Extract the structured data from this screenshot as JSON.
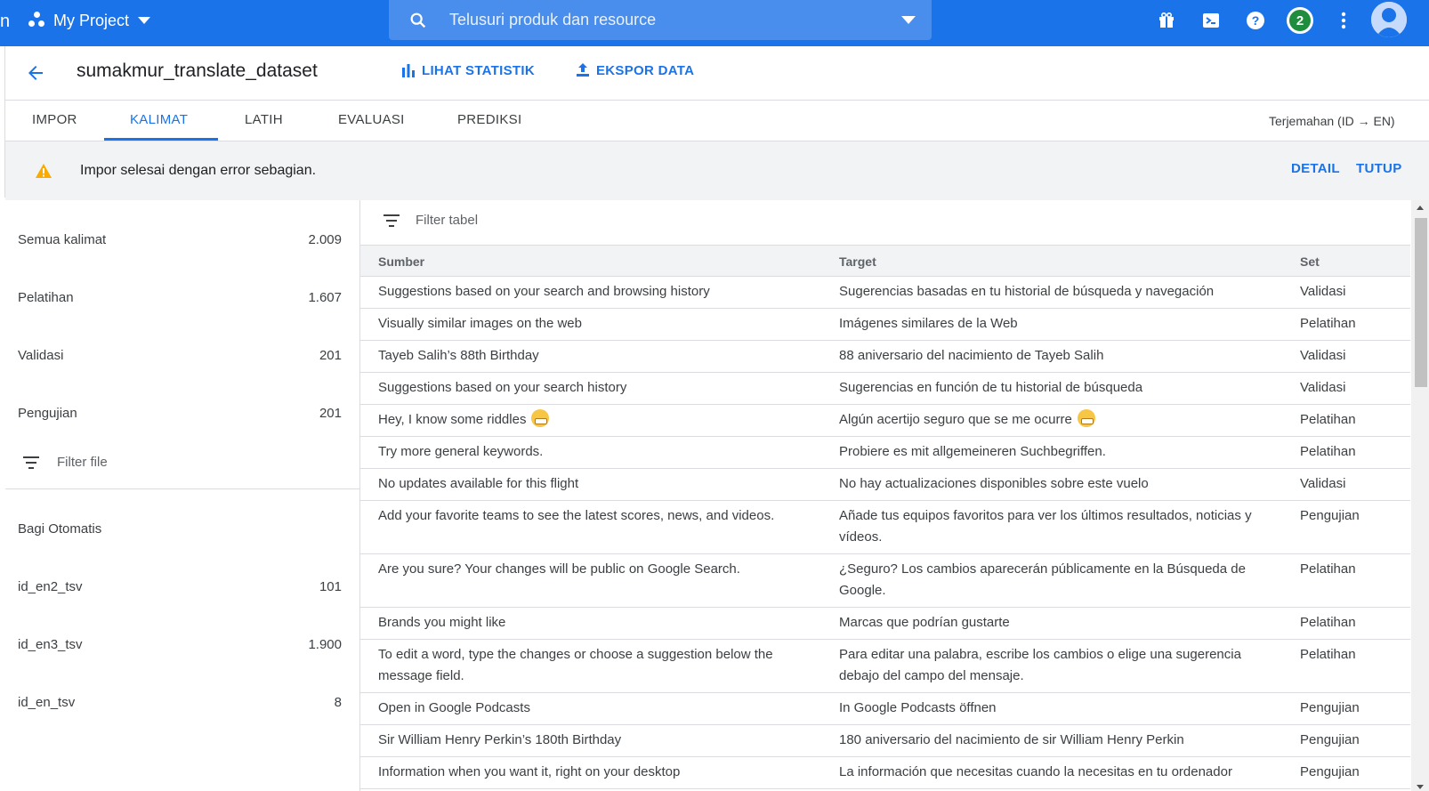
{
  "topbar": {
    "edge_glyph": "n",
    "project_name": "My Project",
    "search_placeholder": "Telusuri produk dan resource",
    "notification_count": "2",
    "colors": {
      "bar": "#1a73e8",
      "search": "#4a8eed",
      "badge": "#1e8e3e"
    }
  },
  "header": {
    "title": "sumakmur_translate_dataset",
    "actions": {
      "stats": "LIHAT STATISTIK",
      "export": "EKSPOR DATA"
    }
  },
  "tabs": [
    "IMPOR",
    "KALIMAT",
    "LATIH",
    "EVALUASI",
    "PREDIKSI"
  ],
  "active_tab": "KALIMAT",
  "language_pair": "Terjemahan (ID → EN)",
  "banner": {
    "message": "Impor selesai dengan error sebagian.",
    "detail": "DETAIL",
    "close": "TUTUP"
  },
  "sidebar": {
    "stats": [
      {
        "label": "Semua kalimat",
        "value": "2.009"
      },
      {
        "label": "Pelatihan",
        "value": "1.607"
      },
      {
        "label": "Validasi",
        "value": "201"
      },
      {
        "label": "Pengujian",
        "value": "201"
      }
    ],
    "filter_placeholder": "Filter file",
    "files": [
      {
        "label": "Bagi Otomatis",
        "value": ""
      },
      {
        "label": "id_en2_tsv",
        "value": "101"
      },
      {
        "label": "id_en3_tsv",
        "value": "1.900"
      },
      {
        "label": "id_en_tsv",
        "value": "8"
      }
    ]
  },
  "table": {
    "filter_placeholder": "Filter tabel",
    "headers": {
      "source": "Sumber",
      "target": "Target",
      "set": "Set"
    },
    "rows": [
      {
        "source": "Suggestions based on your search and browsing history",
        "target": "Sugerencias basadas en tu historial de búsqueda y navegación",
        "set": "Validasi"
      },
      {
        "source": "Visually similar images on the web",
        "target": "Imágenes similares de la Web",
        "set": "Pelatihan"
      },
      {
        "source": "Tayeb Salih’s 88th Birthday",
        "target": "88 aniversario del nacimiento de Tayeb Salih",
        "set": "Validasi"
      },
      {
        "source": "Suggestions based on your search history",
        "target": "Sugerencias en función de tu historial de búsqueda",
        "set": "Validasi"
      },
      {
        "source": "Hey, I know some riddles",
        "target": "Algún acertijo seguro que se me ocurre",
        "set": "Pelatihan",
        "emoji": true
      },
      {
        "source": "Try more general keywords.",
        "target": "Probiere es mit allgemeineren Suchbegriffen.",
        "set": "Pelatihan"
      },
      {
        "source": "No updates available for this flight",
        "target": "No hay actualizaciones disponibles sobre este vuelo",
        "set": "Validasi"
      },
      {
        "source": "Add your favorite teams to see the latest scores, news, and videos.",
        "target": "Añade tus equipos favoritos para ver los últimos resultados, noticias y vídeos.",
        "set": "Pengujian"
      },
      {
        "source": "Are you sure? Your changes will be public on Google Search.",
        "target": "¿Seguro? Los cambios aparecerán públicamente en la Búsqueda de Google.",
        "set": "Pelatihan"
      },
      {
        "source": "Brands you might like",
        "target": "Marcas que podrían gustarte",
        "set": "Pelatihan"
      },
      {
        "source": "To edit a word, type the changes or choose a suggestion below the message field.",
        "target": "Para editar una palabra, escribe los cambios o elige una sugerencia debajo del campo del mensaje.",
        "set": "Pelatihan"
      },
      {
        "source": "Open in Google Podcasts",
        "target": "In Google Podcasts öffnen",
        "set": "Pengujian"
      },
      {
        "source": "Sir William Henry Perkin’s 180th Birthday",
        "target": "180 aniversario del nacimiento de sir William Henry Perkin",
        "set": "Pengujian"
      },
      {
        "source": "Information when you want it, right on your desktop",
        "target": "La información que necesitas cuando la necesitas en tu ordenador",
        "set": "Pengujian"
      }
    ]
  },
  "icons": [
    "menu-edge-icon",
    "project-icon",
    "search-icon",
    "gift-icon",
    "cloud-shell-icon",
    "help-icon",
    "more-vert-icon",
    "avatar-icon",
    "back-arrow-icon",
    "bar-chart-icon",
    "upload-icon",
    "warning-icon",
    "filter-icon"
  ]
}
